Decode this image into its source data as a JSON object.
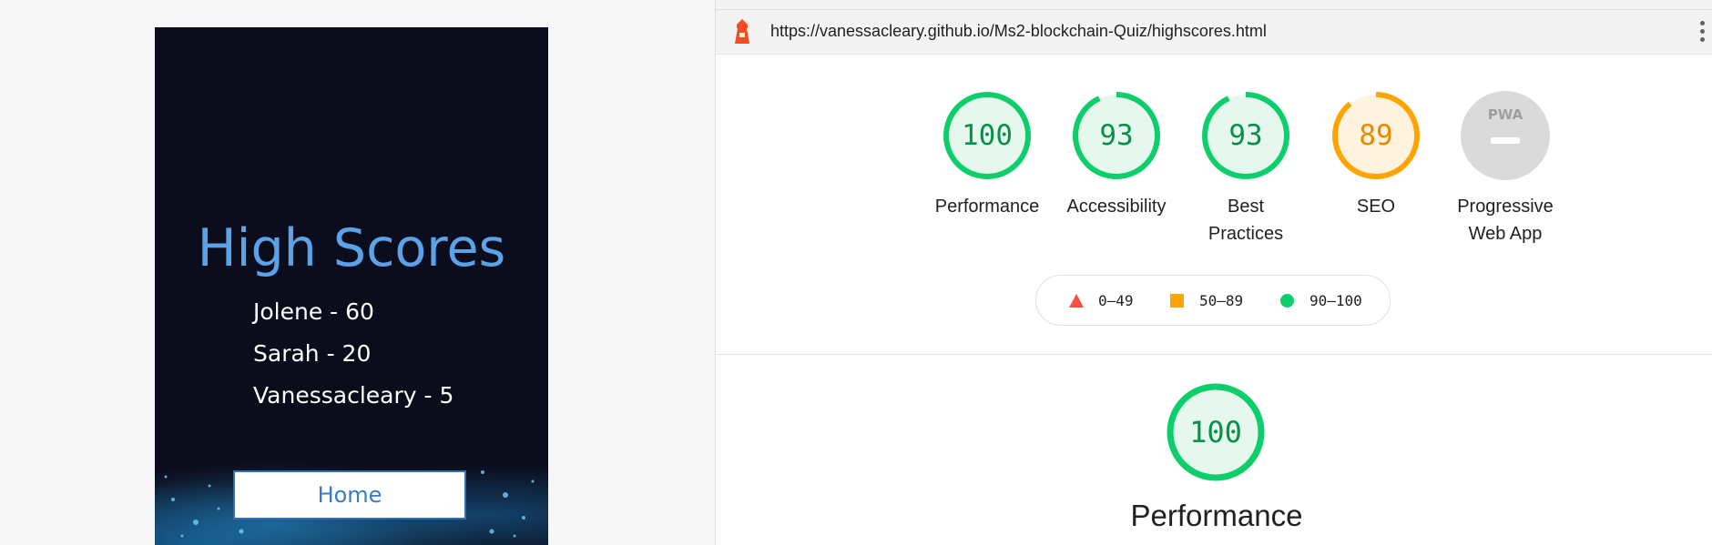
{
  "app": {
    "title": "High Scores",
    "scores": [
      "Jolene - 60",
      "Sarah - 20",
      "Vanessacleary - 5"
    ],
    "home_label": "Home"
  },
  "report": {
    "url": "https://vanessacleary.github.io/Ms2-blockchain-Quiz/highscores.html",
    "gauges": [
      {
        "score": "100",
        "value": 100,
        "label_lines": [
          "Performance"
        ],
        "status": "pass"
      },
      {
        "score": "93",
        "value": 93,
        "label_lines": [
          "Accessibility"
        ],
        "status": "pass"
      },
      {
        "score": "93",
        "value": 93,
        "label_lines": [
          "Best",
          "Practices"
        ],
        "status": "pass"
      },
      {
        "score": "89",
        "value": 89,
        "label_lines": [
          "SEO"
        ],
        "status": "average"
      },
      {
        "score": "",
        "value": null,
        "label_lines": [
          "Progressive",
          "Web App"
        ],
        "status": "pwa",
        "badge_text": "PWA"
      }
    ],
    "legend": [
      {
        "shape": "triangle",
        "range": "0–49",
        "color": "#ff4e42"
      },
      {
        "shape": "square",
        "range": "50–89",
        "color": "#ffa400"
      },
      {
        "shape": "circle",
        "range": "90–100",
        "color": "#0cce6b"
      }
    ],
    "focus": {
      "score": "100",
      "value": 100,
      "title": "Performance"
    }
  },
  "colors": {
    "pass_ring": "#0cce6b",
    "pass_fill": "#e6f8ee",
    "pass_text": "#0a8f4a",
    "avg_ring": "#ffa400",
    "avg_fill": "#fff3e0",
    "avg_text": "#e68a00",
    "pwa_fill": "#dadada",
    "title_blue": "#5aa3e8"
  },
  "icons": {
    "lighthouse": "lighthouse-icon",
    "menu": "kebab-menu-icon"
  }
}
